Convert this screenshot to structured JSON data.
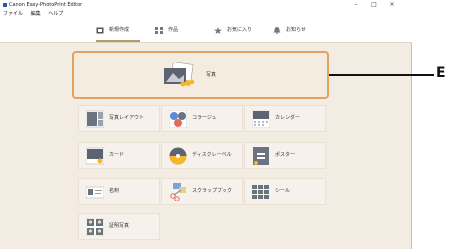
{
  "window": {
    "title": "Canon Easy-PhotoPrint Editor"
  },
  "window_controls": {
    "minimize": "–",
    "maximize": "□",
    "close": "×"
  },
  "menu": [
    "ファイル",
    "編集",
    "ヘルプ"
  ],
  "tabs": [
    {
      "label": "新規作成",
      "icon": "new-icon",
      "active": true
    },
    {
      "label": "作品",
      "icon": "grid-icon",
      "active": false
    },
    {
      "label": "お気に入り",
      "icon": "star-icon",
      "active": false
    },
    {
      "label": "お知らせ",
      "icon": "bell-icon",
      "active": false
    }
  ],
  "photo_card": {
    "label": "写真",
    "icon": "photo-icon"
  },
  "tiles": [
    {
      "label": "写真レイアウト",
      "icon": "photo-layout-icon"
    },
    {
      "label": "コラージュ",
      "icon": "collage-icon"
    },
    {
      "label": "カレンダー",
      "icon": "calendar-icon"
    },
    {
      "label": "カード",
      "icon": "card-icon"
    },
    {
      "label": "ディスクレーベル",
      "icon": "disc-label-icon"
    },
    {
      "label": "ポスター",
      "icon": "poster-icon"
    },
    {
      "label": "名刺",
      "icon": "business-card-icon"
    },
    {
      "label": "スクラップブック",
      "icon": "scrapbook-icon"
    },
    {
      "label": "シール",
      "icon": "sticker-icon"
    },
    {
      "label": "証明写真",
      "icon": "id-photo-icon"
    }
  ],
  "callout": {
    "letter": "E"
  },
  "colors": {
    "accent": "#e3a15e",
    "background": "#f2ece3",
    "tile": "#f6f2eb"
  }
}
